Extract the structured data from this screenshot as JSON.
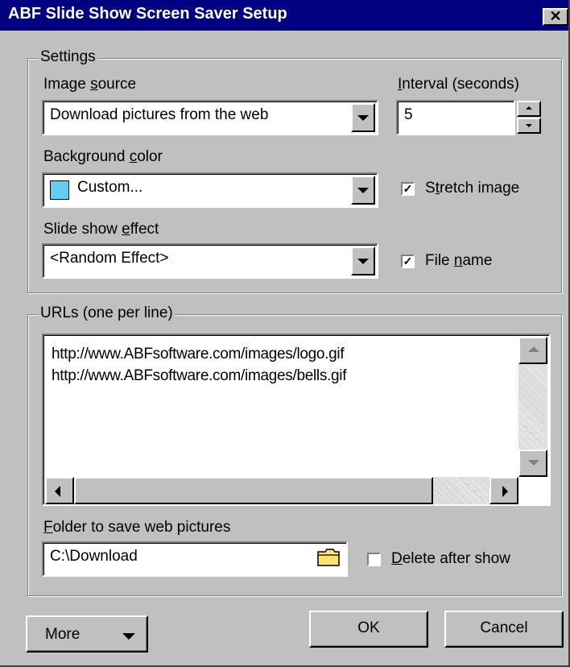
{
  "window": {
    "title": "ABF Slide Show Screen Saver Setup",
    "close_glyph": "✕"
  },
  "settings": {
    "legend": "Settings",
    "image_source": {
      "label": "Image source",
      "value": "Download pictures from the web"
    },
    "interval": {
      "label": "Interval (seconds)",
      "value": "5"
    },
    "background_color": {
      "label": "Background color",
      "value": "Custom...",
      "swatch": "#66ccee"
    },
    "stretch_image": {
      "label": "Stretch image",
      "checked": true
    },
    "effect": {
      "label": "Slide show effect",
      "value": "<Random Effect>"
    },
    "file_name": {
      "label": "File name",
      "checked": true
    }
  },
  "urls": {
    "legend": "URLs (one per line)",
    "lines": [
      "http://www.ABFsoftware.com/images/logo.gif",
      "http://www.ABFsoftware.com/images/bells.gif"
    ]
  },
  "folder": {
    "label": "Folder to save web pictures",
    "value": "C:\\Download"
  },
  "delete_after_show": {
    "label": "Delete after show",
    "checked": false
  },
  "buttons": {
    "more": "More",
    "ok": "OK",
    "cancel": "Cancel"
  },
  "icons": {
    "folder": "folder-icon",
    "dropdown": "chevron-down-icon",
    "check": "check-icon"
  },
  "colors": {
    "titlebar": "#000080",
    "face": "#c0c0c0",
    "folder_icon": "#ffe36e"
  }
}
